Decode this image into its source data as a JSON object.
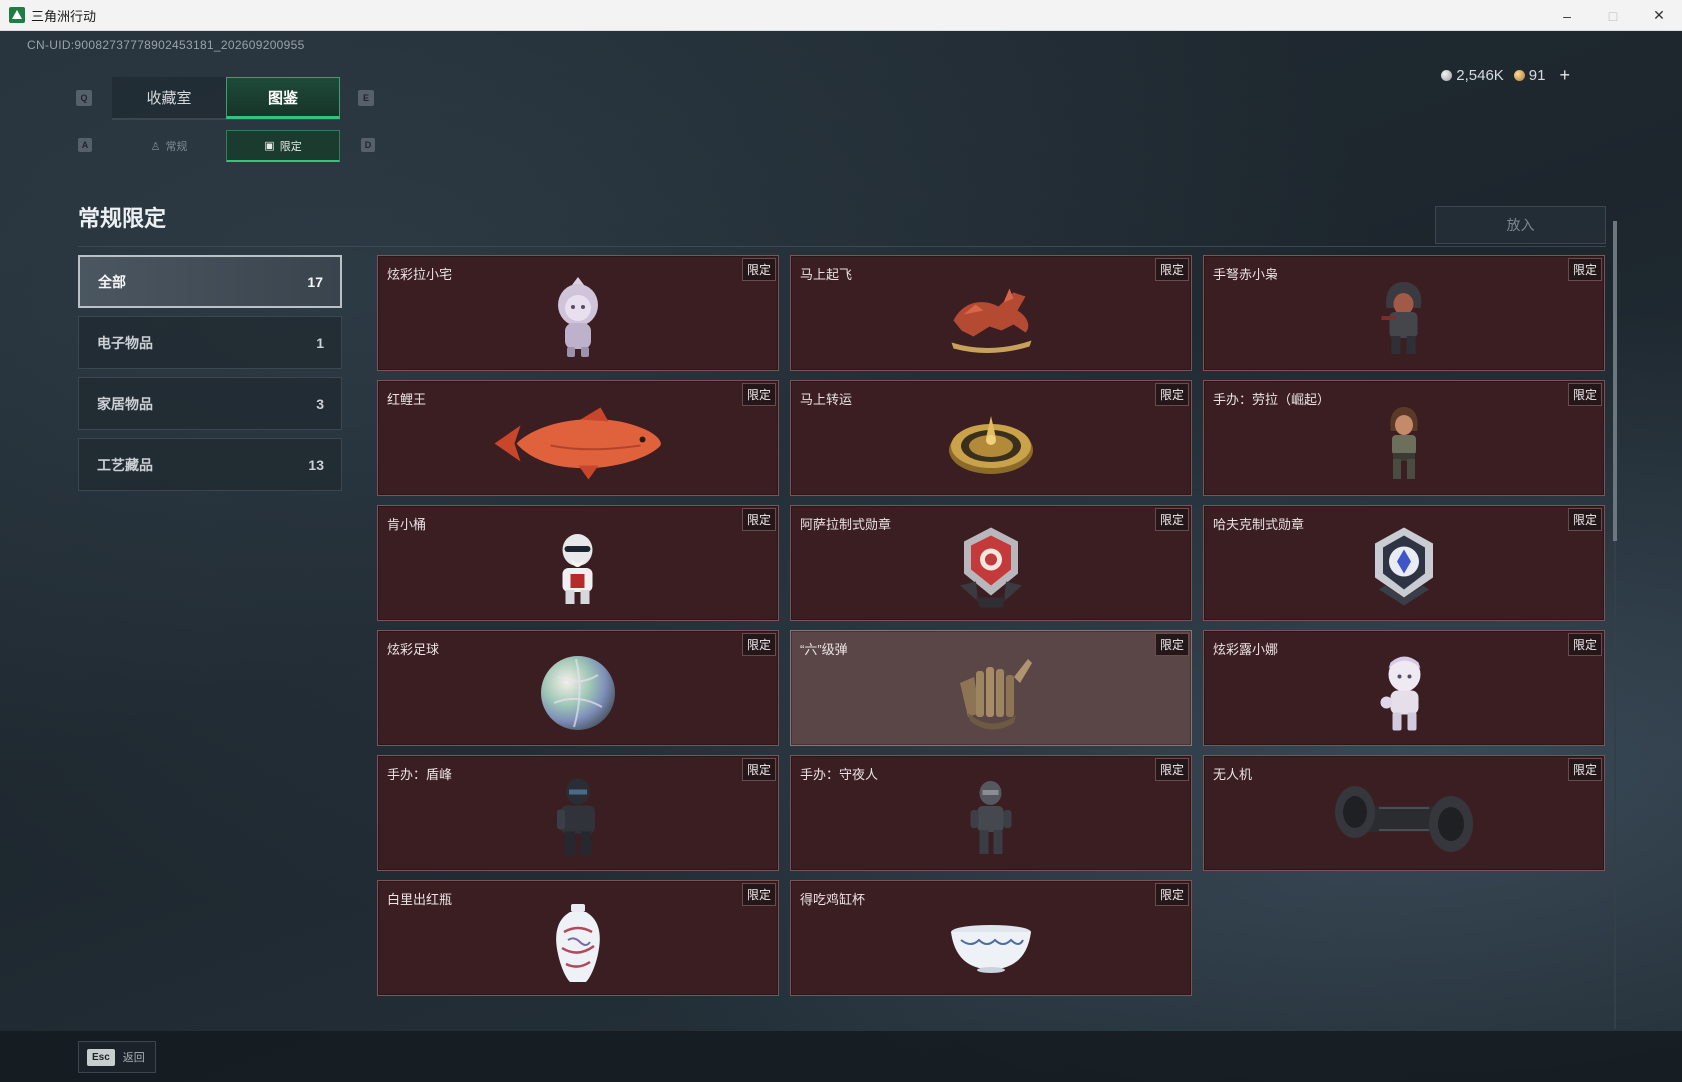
{
  "window": {
    "title": "三角洲行动",
    "minimize": "–",
    "maximize": "□",
    "close": "✕"
  },
  "header": {
    "uid": "CN-UID:9008273777890245318​1_202609200955",
    "currency_silver": "2,546K",
    "currency_gold": "91",
    "add": "+"
  },
  "keys": {
    "q": "Q",
    "e": "E",
    "a": "A",
    "d": "D"
  },
  "top_tabs": [
    {
      "label": "收藏室",
      "active": false
    },
    {
      "label": "图鉴",
      "active": true
    }
  ],
  "sub_tabs": [
    {
      "label": "常规",
      "icon": "figure-icon",
      "active": false
    },
    {
      "label": "限定",
      "icon": "image-icon",
      "active": true
    }
  ],
  "section": {
    "title": "常规限定",
    "put_in": "放入"
  },
  "categories": [
    {
      "label": "全部",
      "count": "17",
      "active": true
    },
    {
      "label": "电子物品",
      "count": "1",
      "active": false
    },
    {
      "label": "家居物品",
      "count": "3",
      "active": false
    },
    {
      "label": "工艺藏品",
      "count": "13",
      "active": false
    }
  ],
  "items": [
    {
      "name": "炫彩拉小宅",
      "badge": "限定",
      "icon": "figurine-hoodie-icon"
    },
    {
      "name": "马上起飞",
      "badge": "限定",
      "icon": "red-horse-icon"
    },
    {
      "name": "手弩赤小枭",
      "badge": "限定",
      "icon": "hooded-figure-icon"
    },
    {
      "name": "红鲤王",
      "badge": "限定",
      "icon": "koi-fish-icon"
    },
    {
      "name": "马上转运",
      "badge": "限定",
      "icon": "golden-compass-icon"
    },
    {
      "name": "手办：劳拉（崛起）",
      "badge": "限定",
      "icon": "lara-figure-icon"
    },
    {
      "name": "肯小桶",
      "badge": "限定",
      "icon": "colonel-figure-icon"
    },
    {
      "name": "阿萨拉制式勋章",
      "badge": "限定",
      "icon": "red-medal-icon"
    },
    {
      "name": "哈夫克制式勋章",
      "badge": "限定",
      "icon": "blue-medal-icon"
    },
    {
      "name": "炫彩足球",
      "badge": "限定",
      "icon": "iridescent-ball-icon"
    },
    {
      "name": "“六”级弹",
      "badge": "限定",
      "icon": "bullet-hand-icon"
    },
    {
      "name": "炫彩露小娜",
      "badge": "限定",
      "icon": "white-figure-icon"
    },
    {
      "name": "手办：盾峰",
      "badge": "限定",
      "icon": "armored-figure-icon"
    },
    {
      "name": "手办：守夜人",
      "badge": "限定",
      "icon": "nightwatch-figure-icon"
    },
    {
      "name": "无人机",
      "badge": "限定",
      "icon": "drone-roller-icon"
    },
    {
      "name": "白里出红瓶",
      "badge": "限定",
      "icon": "porcelain-vase-icon"
    },
    {
      "name": "得吃鸡缸杯",
      "badge": "限定",
      "icon": "porcelain-cup-icon"
    }
  ],
  "footer": {
    "esc": "Esc",
    "back": "返回"
  }
}
